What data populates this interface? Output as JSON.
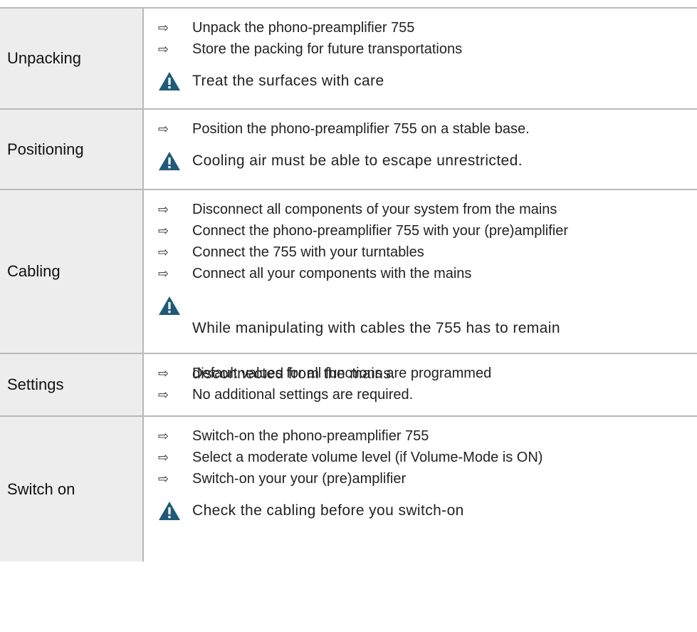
{
  "rows": [
    {
      "label": "Unpacking",
      "steps": [
        "Unpack the phono-preamplifier 755",
        "Store the packing for future transportations"
      ],
      "warning": "Treat the surfaces with care"
    },
    {
      "label": "Positioning",
      "steps": [
        "Position the phono-preamplifier 755 on a stable base."
      ],
      "warning": "Cooling air must be able to escape unrestricted."
    },
    {
      "label": "Cabling",
      "steps": [
        "Disconnect all components of your system from the mains",
        "Connect the phono-preamplifier 755 with your (pre)amplifier",
        "Connect the 755 with your turntables",
        "Connect all your components with the mains"
      ],
      "warning_line1": "While manipulating with cables the 755 has to remain",
      "warning_line2": "disconnected from the mains."
    },
    {
      "label": "Settings",
      "steps": [
        "Default values for all functions are programmed",
        "No additional settings are required."
      ]
    },
    {
      "label": "Switch on",
      "steps": [
        "Switch-on the phono-preamplifier 755",
        "Select a moderate volume level (if Volume-Mode is ON)",
        "Switch-on your your (pre)amplifier"
      ],
      "warning": "Check the cabling before you switch-on"
    }
  ],
  "icons": {
    "step": "arrow-right-icon",
    "warning": "warning-triangle-icon"
  },
  "colors": {
    "label_bg": "#ededed",
    "border": "#b9b9b9",
    "warning_icon": "#1f5a78"
  }
}
